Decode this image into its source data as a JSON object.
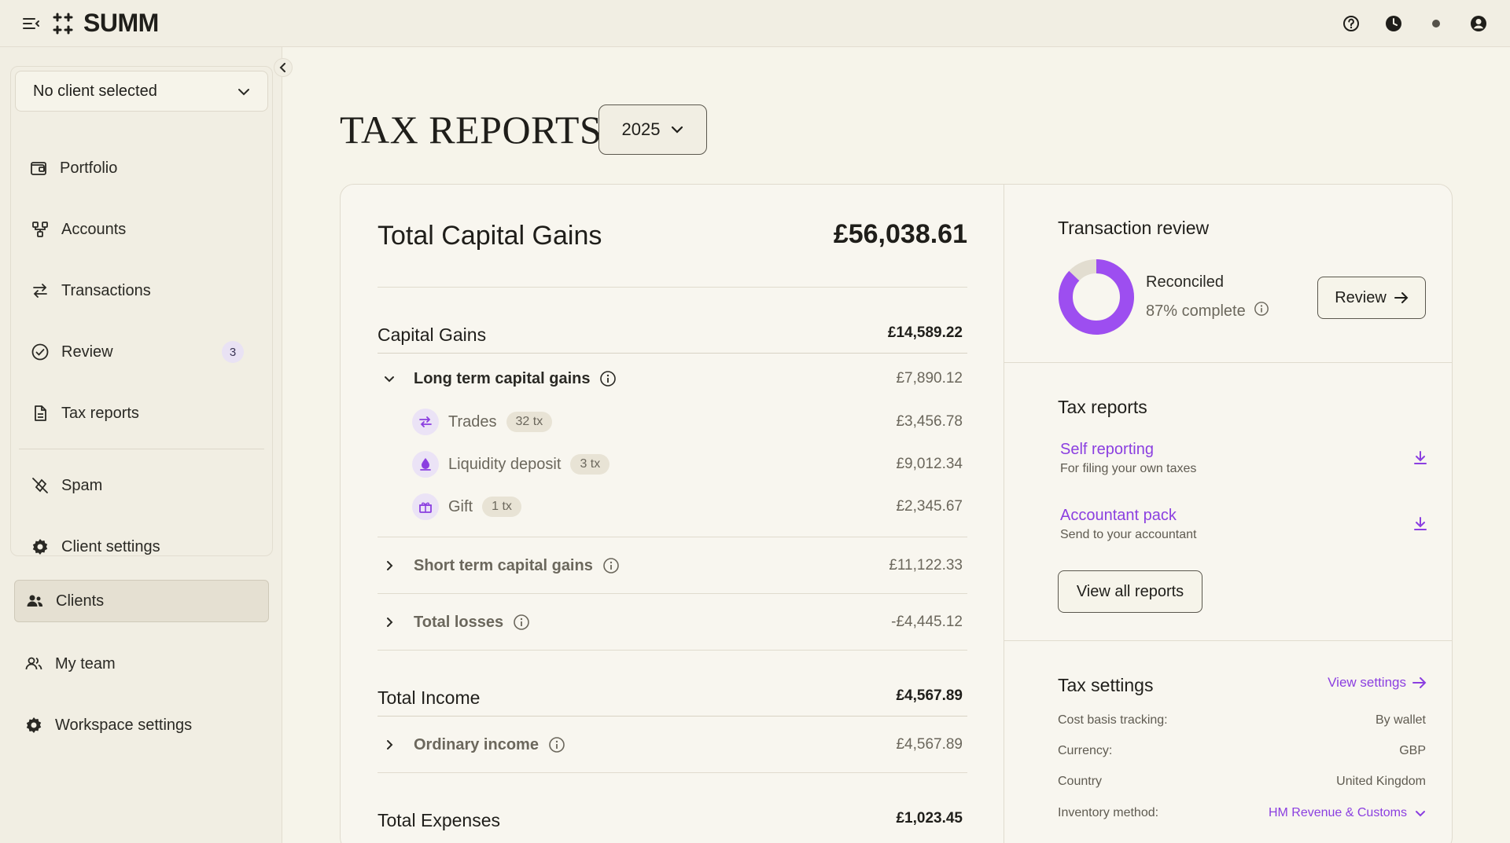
{
  "app": {
    "logo_text": "SUMM"
  },
  "sidebar": {
    "client_select": "No client selected",
    "items": [
      {
        "label": "Portfolio"
      },
      {
        "label": "Accounts"
      },
      {
        "label": "Transactions"
      },
      {
        "label": "Review",
        "badge": "3"
      },
      {
        "label": "Tax reports"
      },
      {
        "label": "Spam"
      },
      {
        "label": "Client settings"
      }
    ],
    "workspace": [
      {
        "label": "Clients"
      },
      {
        "label": "My team"
      },
      {
        "label": "Workspace settings"
      }
    ]
  },
  "page": {
    "title": "TAX REPORTS",
    "year": "2025"
  },
  "gains": {
    "total_title": "Total Capital Gains",
    "total_value": "£56,038.61",
    "capital_gains": {
      "title": "Capital Gains",
      "value": "£14,589.22"
    },
    "long_term": {
      "label": "Long term capital gains",
      "value": "£7,890.12"
    },
    "subitems": [
      {
        "label": "Trades",
        "pill": "32 tx",
        "value": "£3,456.78"
      },
      {
        "label": "Liquidity deposit",
        "pill": "3 tx",
        "value": "£9,012.34"
      },
      {
        "label": "Gift",
        "pill": "1 tx",
        "value": "£2,345.67"
      }
    ],
    "short_term": {
      "label": "Short term capital gains",
      "value": "£11,122.33"
    },
    "losses": {
      "label": "Total losses",
      "value": "-£4,445.12"
    },
    "income": {
      "title": "Total Income",
      "value": "£4,567.89"
    },
    "ordinary": {
      "label": "Ordinary income",
      "value": "£4,567.89"
    },
    "expenses": {
      "title": "Total Expenses",
      "value": "£1,023.45"
    }
  },
  "review": {
    "title": "Transaction review",
    "status": "Reconciled",
    "progress_text": "87% complete",
    "progress": 0.87,
    "button": "Review"
  },
  "reports": {
    "title": "Tax reports",
    "items": [
      {
        "title": "Self reporting",
        "subtitle": "For filing your own taxes"
      },
      {
        "title": "Accountant pack",
        "subtitle": "Send to your accountant"
      }
    ],
    "view_all": "View all reports"
  },
  "settings": {
    "title": "Tax settings",
    "view_link": "View settings",
    "rows": [
      {
        "key": "Cost basis tracking:",
        "value": "By wallet"
      },
      {
        "key": "Currency:",
        "value": "GBP"
      },
      {
        "key": "Country",
        "value": "United Kingdom"
      },
      {
        "key": "Inventory method:",
        "value": "HM Revenue & Customs"
      }
    ]
  },
  "colors": {
    "accent": "#8b3fe0",
    "background": "#f6f4ea",
    "donut_track": "#e2ddd0"
  }
}
